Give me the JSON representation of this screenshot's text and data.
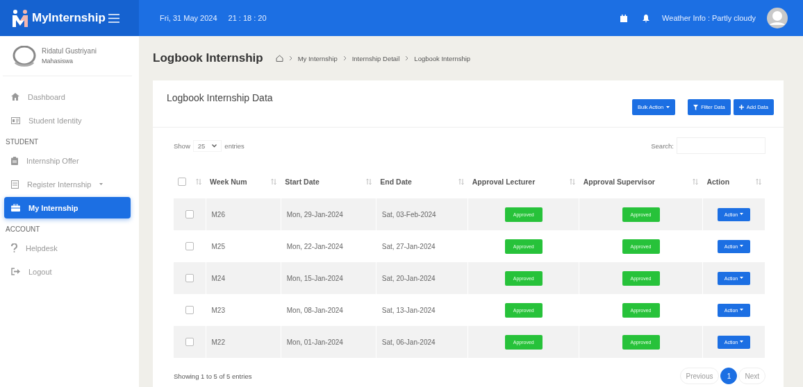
{
  "header": {
    "brand": "MyInternship",
    "date": "Fri, 31 May 2024",
    "time": "21 : 18 : 20",
    "weather": "Weather Info : Partly cloudy"
  },
  "user": {
    "name": "Ridatul Gustriyani",
    "role": "Mahasiswa"
  },
  "sidebar": {
    "items": [
      {
        "kind": "link",
        "label": "Dashboard",
        "selected": false,
        "dropdown": false
      },
      {
        "kind": "link",
        "label": "Student Identity",
        "selected": false,
        "dropdown": false
      },
      {
        "kind": "section",
        "label": "STUDENT"
      },
      {
        "kind": "link",
        "label": "Internship Offer",
        "selected": false,
        "dropdown": false
      },
      {
        "kind": "link",
        "label": "Register Internship",
        "selected": false,
        "dropdown": true
      },
      {
        "kind": "link",
        "label": "My Internship",
        "selected": true,
        "dropdown": false
      },
      {
        "kind": "section",
        "label": "ACCOUNT"
      },
      {
        "kind": "link",
        "label": "Helpdesk",
        "selected": false,
        "dropdown": false
      },
      {
        "kind": "link",
        "label": "Logout",
        "selected": false,
        "dropdown": false
      }
    ]
  },
  "page": {
    "title": "Logbook Internship",
    "breadcrumb": [
      "My Internship",
      "Internship Detail",
      "Logbook Internship"
    ]
  },
  "card": {
    "title": "Logbook Internship Data",
    "buttons": [
      {
        "kind": "dropdown",
        "label": "Bulk Action"
      },
      {
        "kind": "filter",
        "label": "Filter Data"
      },
      {
        "kind": "add",
        "label": "Add Data"
      }
    ]
  },
  "controls": {
    "show_label": "Show",
    "page_size": "25",
    "entries_label": "entries",
    "search_label": "Search:"
  },
  "table": {
    "select_all_checked": false,
    "columns": [
      "Week Num",
      "Start Date",
      "End Date",
      "Approval Lecturer",
      "Approval Supervisor",
      "Action"
    ],
    "rows": [
      {
        "checked": false,
        "week": "M26",
        "start": "Mon, 29-Jan-2024",
        "end": "Sat, 03-Feb-2024",
        "lecturer": {
          "kind": "approved",
          "label": "Approved"
        },
        "supervisor": {
          "kind": "approved",
          "label": "Approved"
        },
        "action": "Action"
      },
      {
        "checked": false,
        "week": "M25",
        "start": "Mon, 22-Jan-2024",
        "end": "Sat, 27-Jan-2024",
        "lecturer": {
          "kind": "approved",
          "label": "Approved"
        },
        "supervisor": {
          "kind": "approved",
          "label": "Approved"
        },
        "action": "Action"
      },
      {
        "checked": false,
        "week": "M24",
        "start": "Mon, 15-Jan-2024",
        "end": "Sat, 20-Jan-2024",
        "lecturer": {
          "kind": "approved",
          "label": "Approved"
        },
        "supervisor": {
          "kind": "approved",
          "label": "Approved"
        },
        "action": "Action"
      },
      {
        "checked": false,
        "week": "M23",
        "start": "Mon, 08-Jan-2024",
        "end": "Sat, 13-Jan-2024",
        "lecturer": {
          "kind": "approved",
          "label": "Approved"
        },
        "supervisor": {
          "kind": "approved",
          "label": "Approved"
        },
        "action": "Action"
      },
      {
        "checked": false,
        "week": "M22",
        "start": "Mon, 01-Jan-2024",
        "end": "Sat, 06-Jan-2024",
        "lecturer": {
          "kind": "approved",
          "label": "Approved"
        },
        "supervisor": {
          "kind": "approved",
          "label": "Approved"
        },
        "action": "Action"
      }
    ]
  },
  "footer": {
    "info": "Showing 1 to 5 of 5 entries",
    "pagination": [
      {
        "label": "Previous",
        "selected": false
      },
      {
        "label": "1",
        "selected": true
      },
      {
        "label": "Next",
        "selected": false
      }
    ]
  }
}
